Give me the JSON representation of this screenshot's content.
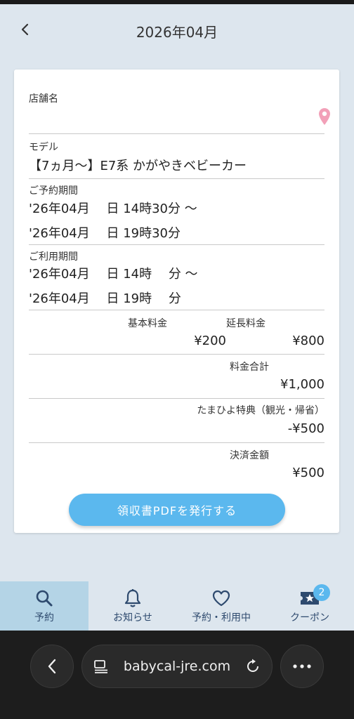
{
  "header": {
    "title": "2026年04月"
  },
  "card": {
    "store_label": "店舗名",
    "model_label": "モデル",
    "model_value": "【7ヵ月〜】E7系 かがやきベビーカー",
    "reserve_label": "ご予約期間",
    "reserve_start": "'26年04月　 日 14時30分 〜",
    "reserve_end": "'26年04月　 日 19時30分",
    "use_label": "ご利用期間",
    "use_start": "'26年04月　 日 14時　 分 〜",
    "use_end": "'26年04月　 日 19時　 分",
    "base_fee_label": "基本料金",
    "base_fee_value": "¥200",
    "ext_fee_label": "延長料金",
    "ext_fee_value": "¥800",
    "total_label": "料金合計",
    "total_value": "¥1,000",
    "benefit_label": "たまひよ特典（観光・帰省）",
    "benefit_value": "-¥500",
    "payment_label": "決済金額",
    "payment_value": "¥500",
    "receipt_button": "領収書PDFを発行する"
  },
  "tabs": [
    {
      "label": "予約",
      "icon": "search-icon",
      "active": true
    },
    {
      "label": "お知らせ",
      "icon": "bell-icon"
    },
    {
      "label": "予約・利用中",
      "icon": "heart-icon"
    },
    {
      "label": "クーポン",
      "icon": "coupon-icon",
      "badge": "2"
    }
  ],
  "browser": {
    "url": "babycal-jre.com"
  },
  "colors": {
    "accent": "#5bb8ee",
    "pin": "#f2a0b8",
    "background": "#dde6ee",
    "tab_active": "#b4d4e6"
  }
}
